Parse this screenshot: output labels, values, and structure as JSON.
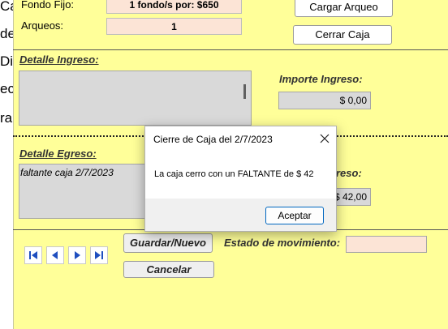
{
  "left_strip": [
    "Ca",
    "de",
    "Dia",
    "ec",
    "ra"
  ],
  "header": {
    "fondo_fijo_label": "Fondo Fijo:",
    "fondo_fijo_value": "1 fondo/s por: $650",
    "arqueos_label": "Arqueos:",
    "arqueos_value": "1",
    "cargar_arqueo_label": "Cargar Arqueo",
    "cerrar_caja_label": "Cerrar Caja"
  },
  "ingreso": {
    "detalle_label": "Detalle Ingreso:",
    "detalle_value": "",
    "importe_label": "Importe Ingreso:",
    "importe_value": "$ 0,00"
  },
  "egreso": {
    "detalle_label": "Detalle Egreso:",
    "detalle_value": "faltante caja 2/7/2023",
    "importe_label_partial": "reso:",
    "importe_value": "$ 42,00"
  },
  "navigation": {
    "icons": [
      "first-record-icon",
      "previous-record-icon",
      "next-record-icon",
      "last-record-icon"
    ]
  },
  "actions": {
    "guardar_label": "Guardar/Nuevo",
    "cancelar_label": "Cancelar",
    "estado_label": "Estado de movimiento:",
    "estado_value": ""
  },
  "dialog": {
    "title": "Cierre de Caja del 2/7/2023",
    "message": "La caja cerro con un FALTANTE de $ 42",
    "ok_label": "Aceptar"
  },
  "colors": {
    "form_background": "#ffff99",
    "field_peach": "#fce4d6",
    "field_grey": "#d9d9d9",
    "dialog_accent": "#0067c0",
    "nav_icon": "#1f4fbf"
  }
}
